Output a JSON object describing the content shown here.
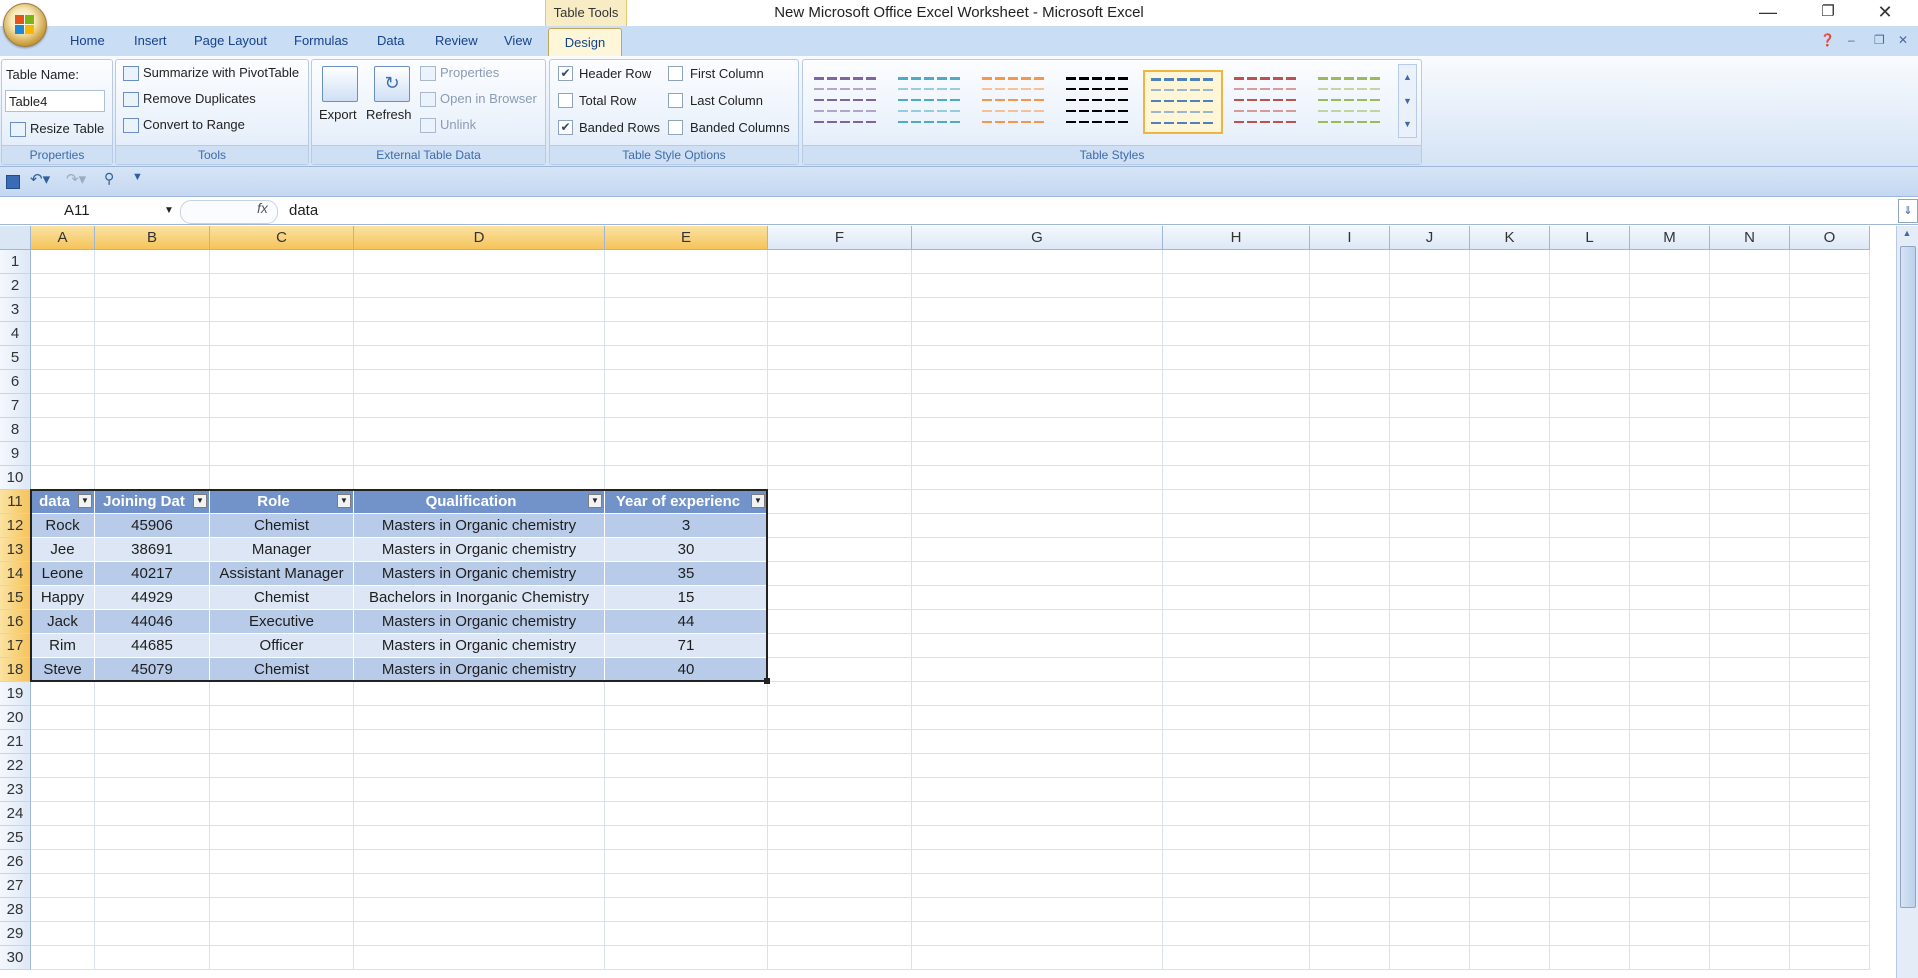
{
  "app": {
    "window_title": "New Microsoft Office Excel Worksheet - Microsoft Excel",
    "context_tab_group": "Table Tools"
  },
  "tabs": [
    "Home",
    "Insert",
    "Page Layout",
    "Formulas",
    "Data",
    "Review",
    "View"
  ],
  "active_tab": "Design",
  "ribbon": {
    "properties": {
      "table_name_label": "Table Name:",
      "table_name_value": "Table4",
      "resize_label": "Resize Table",
      "title": "Properties"
    },
    "tools": {
      "summarize": "Summarize with PivotTable",
      "remove_duplicates": "Remove Duplicates",
      "convert": "Convert to Range",
      "title": "Tools"
    },
    "external": {
      "export": "Export",
      "refresh": "Refresh",
      "properties": "Properties",
      "open_in_browser": "Open in Browser",
      "unlink": "Unlink",
      "title": "External Table Data"
    },
    "style_options": {
      "header_row": "Header Row",
      "total_row": "Total Row",
      "banded_rows": "Banded Rows",
      "first_column": "First Column",
      "last_column": "Last Column",
      "banded_columns": "Banded Columns",
      "title": "Table Style Options",
      "checked": {
        "header_row": true,
        "total_row": false,
        "banded_rows": true,
        "first_column": false,
        "last_column": false,
        "banded_columns": false
      }
    },
    "table_styles": {
      "title": "Table Styles",
      "swatches": [
        "#8064a2",
        "#4bacc6",
        "#f79646",
        "#000000",
        "#4f81bd",
        "#c0504d",
        "#9bbb59"
      ],
      "selected_index": 4
    }
  },
  "formula_bar": {
    "name_box": "A11",
    "fx": "fx",
    "content": "data"
  },
  "columns": [
    "A",
    "B",
    "C",
    "D",
    "E",
    "F",
    "G",
    "H",
    "I",
    "J",
    "K",
    "L",
    "M",
    "N",
    "O"
  ],
  "rows": [
    "1",
    "2",
    "3",
    "4",
    "5",
    "6",
    "7",
    "8",
    "9",
    "10",
    "11",
    "12",
    "13",
    "14",
    "15",
    "16",
    "17",
    "18",
    "19",
    "20",
    "21",
    "22",
    "23",
    "24",
    "25",
    "26",
    "27",
    "28",
    "29",
    "30"
  ],
  "table": {
    "headers": [
      "data",
      "Joining Dat",
      "Role",
      "Qualification",
      "Year of experienc"
    ],
    "rows": [
      [
        "Rock",
        "45906",
        "Chemist",
        "Masters in Organic chemistry",
        "3"
      ],
      [
        "Jee",
        "38691",
        "Manager",
        "Masters in Organic chemistry",
        "30"
      ],
      [
        "Leone",
        "40217",
        "Assistant Manager",
        "Masters in Organic chemistry",
        "35"
      ],
      [
        "Happy",
        "44929",
        "Chemist",
        "Bachelors in Inorganic Chemistry",
        "15"
      ],
      [
        "Jack",
        "44046",
        "Executive",
        "Masters in Organic chemistry",
        "44"
      ],
      [
        "Rim",
        "44685",
        "Officer",
        "Masters in Organic chemistry",
        "71"
      ],
      [
        "Steve",
        "45079",
        "Chemist",
        "Masters in Organic chemistry",
        "40"
      ]
    ]
  }
}
